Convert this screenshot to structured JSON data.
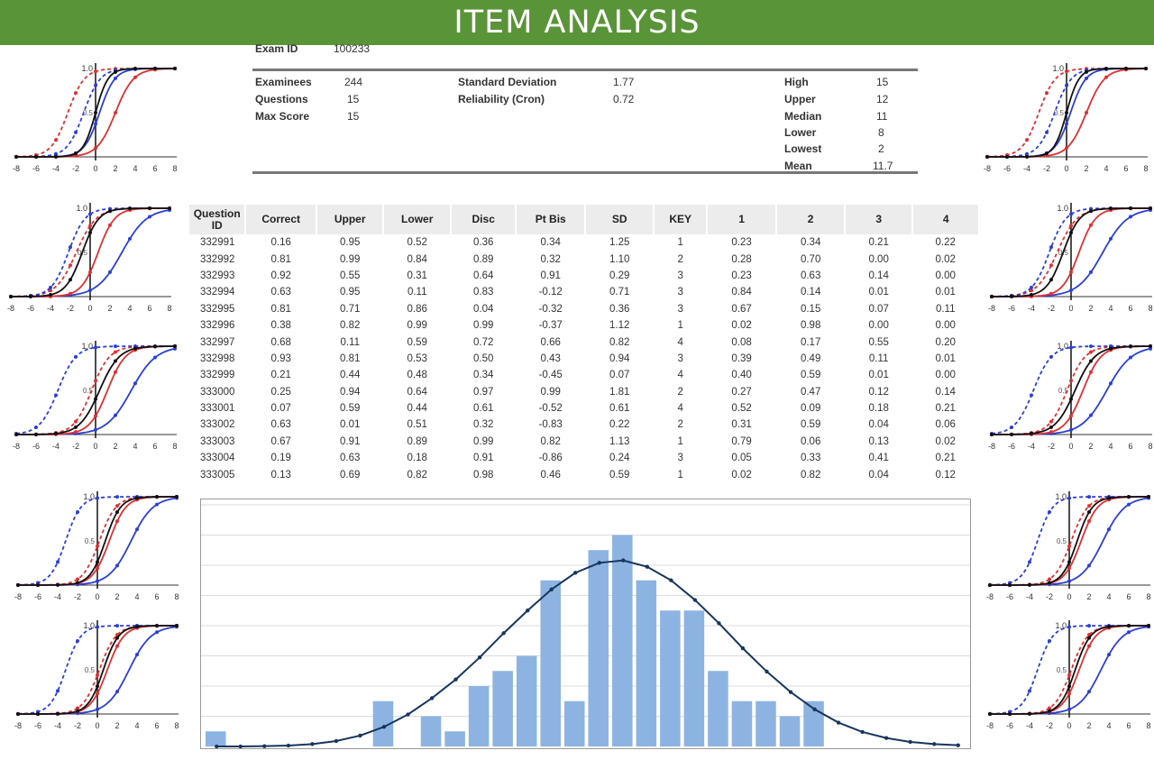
{
  "banner": {
    "title": "ITEM ANALYSIS"
  },
  "colors": {
    "banner": "#5a9438",
    "bar": "#8db3e2",
    "normal_curve": "#17365d",
    "curve_black": "#111111",
    "curve_red": "#e03030",
    "curve_blue": "#2b3fd6"
  },
  "summary": {
    "exam_id_label": "Exam ID",
    "exam_id": "100233",
    "examinees_label": "Examinees",
    "examinees": "244",
    "questions_label": "Questions",
    "questions": "15",
    "max_score_label": "Max Score",
    "max_score": "15",
    "sd_label": "Standard Deviation",
    "sd": "1.77",
    "reliability_label": "Reliability (Cron)",
    "reliability": "0.72",
    "stats": [
      {
        "label": "High",
        "value": "15"
      },
      {
        "label": "Upper",
        "value": "12"
      },
      {
        "label": "Median",
        "value": "11"
      },
      {
        "label": "Lower",
        "value": "8"
      },
      {
        "label": "Lowest",
        "value": "2"
      },
      {
        "label": "Mean",
        "value": "11.7"
      }
    ]
  },
  "chart_data": [
    {
      "type": "table",
      "columns": [
        "Question ID",
        "Correct",
        "Upper",
        "Lower",
        "Disc",
        "Pt Bis",
        "SD",
        "KEY",
        "1",
        "2",
        "3",
        "4"
      ],
      "rows": [
        [
          "332991",
          "0.16",
          "0.95",
          "0.52",
          "0.36",
          "0.34",
          "1.25",
          "1",
          "0.23",
          "0.34",
          "0.21",
          "0.22"
        ],
        [
          "332992",
          "0.81",
          "0.99",
          "0.84",
          "0.89",
          "0.32",
          "1.10",
          "2",
          "0.28",
          "0.70",
          "0.00",
          "0.02"
        ],
        [
          "332993",
          "0.92",
          "0.55",
          "0.31",
          "0.64",
          "0.91",
          "0.29",
          "3",
          "0.23",
          "0.63",
          "0.14",
          "0.00"
        ],
        [
          "332994",
          "0.63",
          "0.95",
          "0.11",
          "0.83",
          "-0.12",
          "0.71",
          "3",
          "0.84",
          "0.14",
          "0.01",
          "0.01"
        ],
        [
          "332995",
          "0.81",
          "0.71",
          "0.86",
          "0.04",
          "-0.32",
          "0.36",
          "3",
          "0.67",
          "0.15",
          "0.07",
          "0.11"
        ],
        [
          "332996",
          "0.38",
          "0.82",
          "0.99",
          "0.99",
          "-0.37",
          "1.12",
          "1",
          "0.02",
          "0.98",
          "0.00",
          "0.00"
        ],
        [
          "332997",
          "0.68",
          "0.11",
          "0.59",
          "0.72",
          "0.66",
          "0.82",
          "4",
          "0.08",
          "0.17",
          "0.55",
          "0.20"
        ],
        [
          "332998",
          "0.93",
          "0.81",
          "0.53",
          "0.50",
          "0.43",
          "0.94",
          "3",
          "0.39",
          "0.49",
          "0.11",
          "0.01"
        ],
        [
          "332999",
          "0.21",
          "0.44",
          "0.48",
          "0.34",
          "-0.45",
          "0.07",
          "4",
          "0.40",
          "0.59",
          "0.01",
          "0.00"
        ],
        [
          "333000",
          "0.25",
          "0.94",
          "0.64",
          "0.97",
          "0.99",
          "1.81",
          "2",
          "0.27",
          "0.47",
          "0.12",
          "0.14"
        ],
        [
          "333001",
          "0.07",
          "0.59",
          "0.44",
          "0.61",
          "-0.52",
          "0.61",
          "4",
          "0.52",
          "0.09",
          "0.18",
          "0.21"
        ],
        [
          "333002",
          "0.63",
          "0.01",
          "0.51",
          "0.32",
          "-0.83",
          "0.22",
          "2",
          "0.31",
          "0.59",
          "0.04",
          "0.06"
        ],
        [
          "333003",
          "0.67",
          "0.91",
          "0.89",
          "0.99",
          "0.82",
          "1.13",
          "1",
          "0.79",
          "0.06",
          "0.13",
          "0.02"
        ],
        [
          "333004",
          "0.19",
          "0.63",
          "0.18",
          "0.91",
          "-0.86",
          "0.24",
          "3",
          "0.05",
          "0.33",
          "0.41",
          "0.21"
        ],
        [
          "333005",
          "0.13",
          "0.69",
          "0.82",
          "0.98",
          "0.46",
          "0.59",
          "1",
          "0.02",
          "0.82",
          "0.04",
          "0.12"
        ]
      ]
    },
    {
      "type": "bar",
      "ylim": [
        0,
        80
      ],
      "grid": true,
      "values": [
        5,
        0,
        0,
        0,
        0,
        0,
        0,
        15,
        0,
        10,
        5,
        20,
        25,
        30,
        55,
        15,
        65,
        70,
        55,
        45,
        45,
        25,
        15,
        15,
        10,
        15,
        0,
        0,
        0,
        0,
        0,
        0
      ],
      "normal_curve": [
        0,
        0,
        0.1,
        0.3,
        0.8,
        1.8,
        3.6,
        6.5,
        10.6,
        16,
        22.2,
        29.5,
        37.5,
        45,
        52,
        57.5,
        60.8,
        61.6,
        59.5,
        55,
        48.5,
        40.8,
        32.5,
        24.8,
        18,
        12.3,
        7.9,
        4.8,
        2.8,
        1.5,
        0.8,
        0.4
      ]
    },
    {
      "type": "line",
      "title": "",
      "x_ticks": [
        "-8",
        "-6",
        "-4",
        "-2",
        "0",
        "2",
        "4",
        "6",
        "8"
      ],
      "y_ticks": [
        "1.0",
        "0.5"
      ],
      "xlim": [
        -8,
        8
      ],
      "ylim": [
        0,
        1
      ],
      "panels": [
        {
          "black": [
            0,
            1.6
          ],
          "red": [
            2,
            1.1
          ],
          "blue": [
            0.4,
            1.3
          ],
          "red_dash": [
            -2.8,
            1.2
          ],
          "blue_dash": [
            -1.2,
            1.2
          ]
        },
        {
          "black": [
            -0.8,
            1.2
          ],
          "red": [
            0.8,
            1.2
          ],
          "blue": [
            3.2,
            0.8
          ],
          "red_dash": [
            -1.4,
            1.0
          ],
          "blue_dash": [
            -2.2,
            1.2
          ]
        },
        {
          "black": [
            0.4,
            1.0
          ],
          "red": [
            1.2,
            1.1
          ],
          "blue": [
            3.6,
            0.8
          ],
          "red_dash": [
            -0.4,
            1.1
          ],
          "blue_dash": [
            -3.8,
            1.1
          ]
        },
        {
          "black": [
            0.8,
            1.3
          ],
          "red": [
            1.2,
            1.2
          ],
          "blue": [
            3.4,
            0.9
          ],
          "red_dash": [
            0.2,
            1.2
          ],
          "blue_dash": [
            -3.2,
            1.3
          ]
        },
        {
          "black": [
            0.6,
            1.3
          ],
          "red": [
            1.0,
            1.2
          ],
          "blue": [
            3.2,
            0.9
          ],
          "red_dash": [
            0.2,
            1.2
          ],
          "blue_dash": [
            -3.2,
            1.3
          ]
        }
      ]
    }
  ]
}
